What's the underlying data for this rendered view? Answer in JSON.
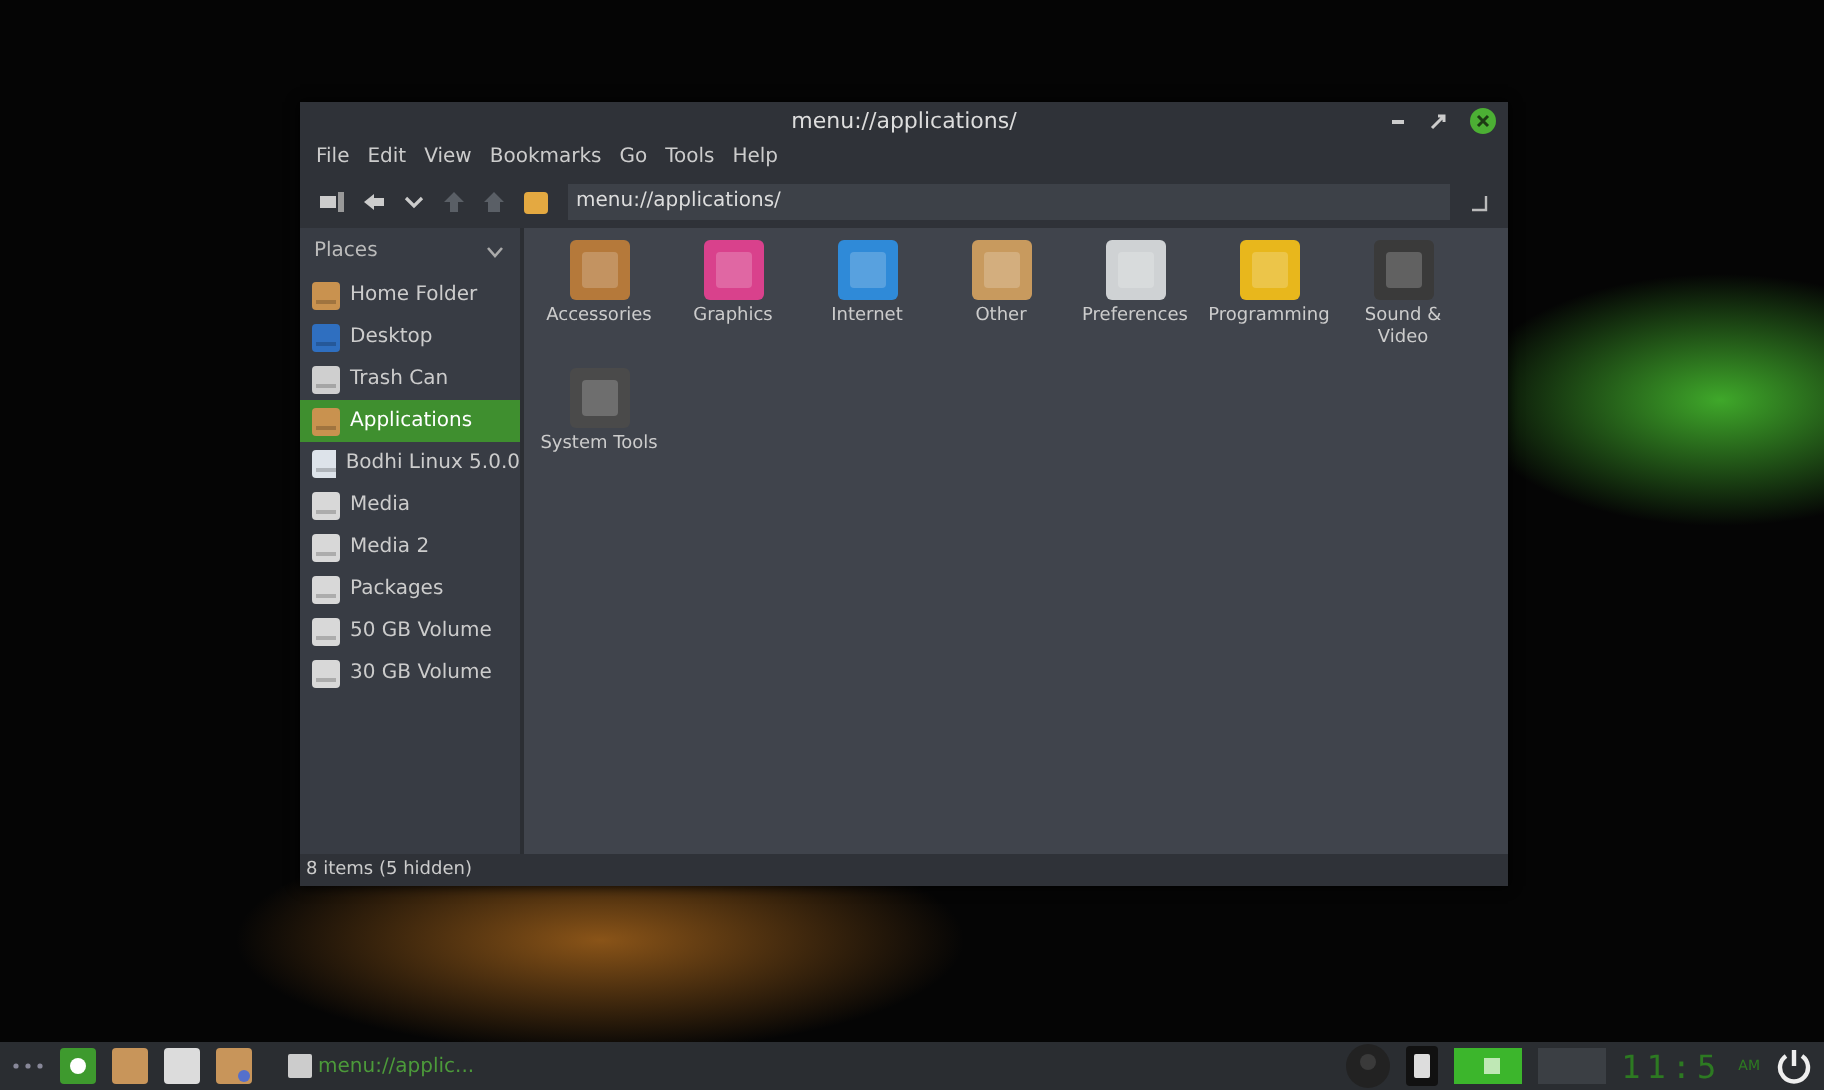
{
  "window": {
    "title": "menu://applications/"
  },
  "menu": [
    "File",
    "Edit",
    "View",
    "Bookmarks",
    "Go",
    "Tools",
    "Help"
  ],
  "location": {
    "value": "menu://applications/"
  },
  "sidebar": {
    "header": "Places",
    "items": [
      {
        "label": "Home Folder",
        "selected": false
      },
      {
        "label": "Desktop",
        "selected": false
      },
      {
        "label": "Trash Can",
        "selected": false
      },
      {
        "label": "Applications",
        "selected": true
      },
      {
        "label": "Bodhi Linux 5.0.0",
        "selected": false
      },
      {
        "label": "Media",
        "selected": false
      },
      {
        "label": "Media 2",
        "selected": false
      },
      {
        "label": "Packages",
        "selected": false
      },
      {
        "label": "50 GB Volume",
        "selected": false
      },
      {
        "label": "30 GB Volume",
        "selected": false
      }
    ]
  },
  "folders": [
    {
      "label": "Accessories"
    },
    {
      "label": "Graphics"
    },
    {
      "label": "Internet"
    },
    {
      "label": "Other"
    },
    {
      "label": "Preferences"
    },
    {
      "label": "Programming"
    },
    {
      "label": "Sound & Video"
    },
    {
      "label": "System Tools"
    }
  ],
  "status_bar": "8 items (5 hidden)",
  "taskbar": {
    "task": "menu://applic...",
    "clock": "11:5",
    "ampm": "AM"
  }
}
